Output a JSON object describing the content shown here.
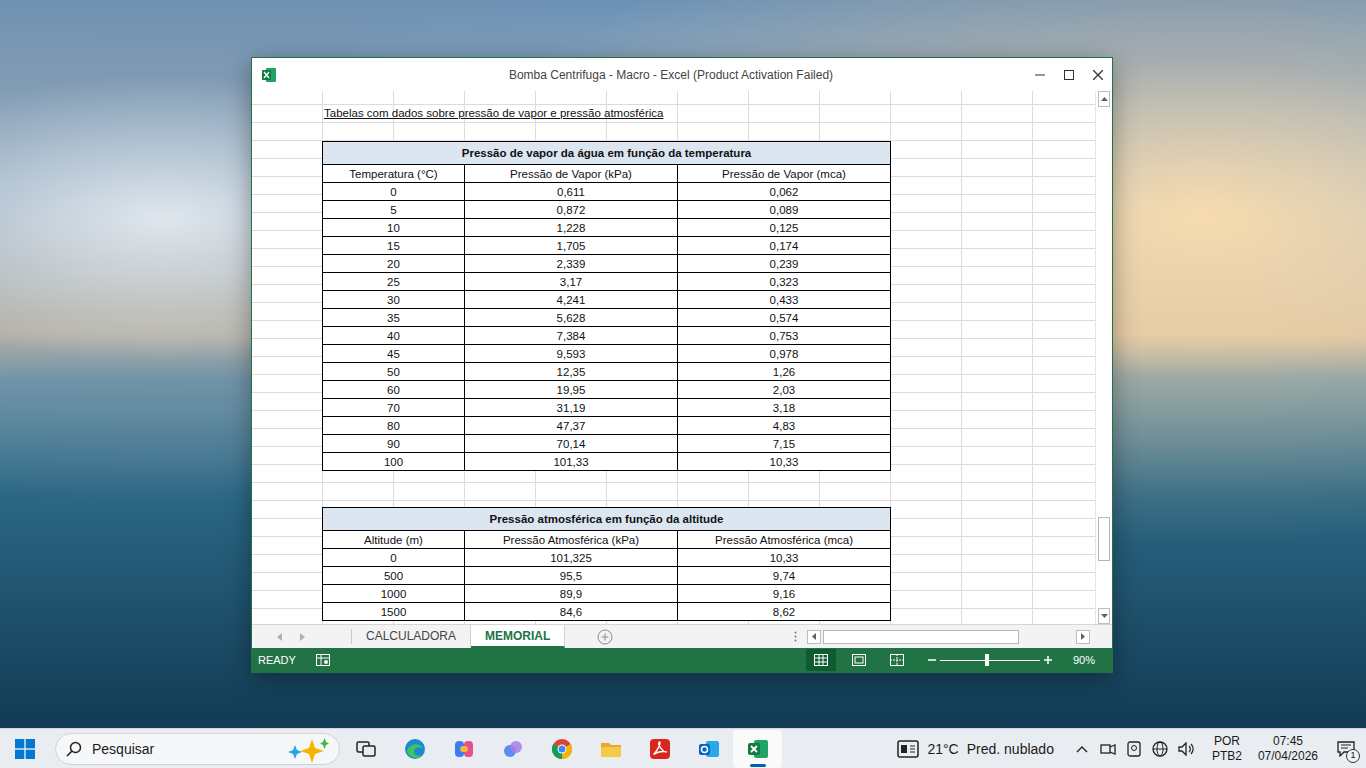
{
  "window": {
    "title": "Bomba Centrifuga - Macro - Excel (Product Activation Failed)"
  },
  "sheet": {
    "heading": "Tabelas com dados sobre pressão de vapor e pressão atmosférica",
    "vertical_scrollbar": {
      "level": 0.9
    },
    "tables": [
      {
        "title": "Pressão de vapor da água em função da temperatura",
        "columns": [
          "Temperatura (°C)",
          "Pressão de Vapor (kPa)",
          "Pressão de Vapor (mca)"
        ],
        "rows": [
          [
            "0",
            "0,611",
            "0,062"
          ],
          [
            "5",
            "0,872",
            "0,089"
          ],
          [
            "10",
            "1,228",
            "0,125"
          ],
          [
            "15",
            "1,705",
            "0,174"
          ],
          [
            "20",
            "2,339",
            "0,239"
          ],
          [
            "25",
            "3,17",
            "0,323"
          ],
          [
            "30",
            "4,241",
            "0,433"
          ],
          [
            "35",
            "5,628",
            "0,574"
          ],
          [
            "40",
            "7,384",
            "0,753"
          ],
          [
            "45",
            "9,593",
            "0,978"
          ],
          [
            "50",
            "12,35",
            "1,26"
          ],
          [
            "60",
            "19,95",
            "2,03"
          ],
          [
            "70",
            "31,19",
            "3,18"
          ],
          [
            "80",
            "47,37",
            "4,83"
          ],
          [
            "90",
            "70,14",
            "7,15"
          ],
          [
            "100",
            "101,33",
            "10,33"
          ]
        ]
      },
      {
        "title": "Pressão atmosférica em função da altitude",
        "columns": [
          "Altitude (m)",
          "Pressão Atmosférica (kPa)",
          "Pressão Atmosférica (mca)"
        ],
        "rows": [
          [
            "0",
            "101,325",
            "10,33"
          ],
          [
            "500",
            "95,5",
            "9,74"
          ],
          [
            "1000",
            "89,9",
            "9,16"
          ],
          [
            "1500",
            "84,6",
            "8,62"
          ]
        ]
      }
    ]
  },
  "sheet_tabs": [
    {
      "label": "CALCULADORA",
      "selected": false
    },
    {
      "label": "MEMORIAL",
      "selected": true
    }
  ],
  "horizontal_scrollbar": {
    "level": 0.78
  },
  "status_bar": {
    "state": "READY",
    "zoom": "90%",
    "zoom_level": 0.47,
    "views": [
      {
        "kind": "normal",
        "selected": true
      },
      {
        "kind": "page-layout",
        "selected": false
      },
      {
        "kind": "page-break",
        "selected": false
      }
    ]
  },
  "taskbar": {
    "search": {
      "placeholder": "Pesquisar"
    },
    "apps": [
      {
        "kind": "task-view",
        "active": false
      },
      {
        "kind": "edge",
        "active": false
      },
      {
        "kind": "copilot",
        "active": false
      },
      {
        "kind": "snip",
        "active": false
      },
      {
        "kind": "chrome",
        "active": false
      },
      {
        "kind": "explorer",
        "active": false
      },
      {
        "kind": "acrobat",
        "active": false
      },
      {
        "kind": "outlook",
        "active": false
      },
      {
        "kind": "excel",
        "active": true
      }
    ],
    "weather": {
      "temperature": "21°C",
      "condition": "Pred. nublado"
    },
    "language": {
      "lang": "POR",
      "layout": "PTB2"
    },
    "clock": {
      "time": "07:45",
      "date": "07/04/2026"
    },
    "notifications": "1"
  }
}
